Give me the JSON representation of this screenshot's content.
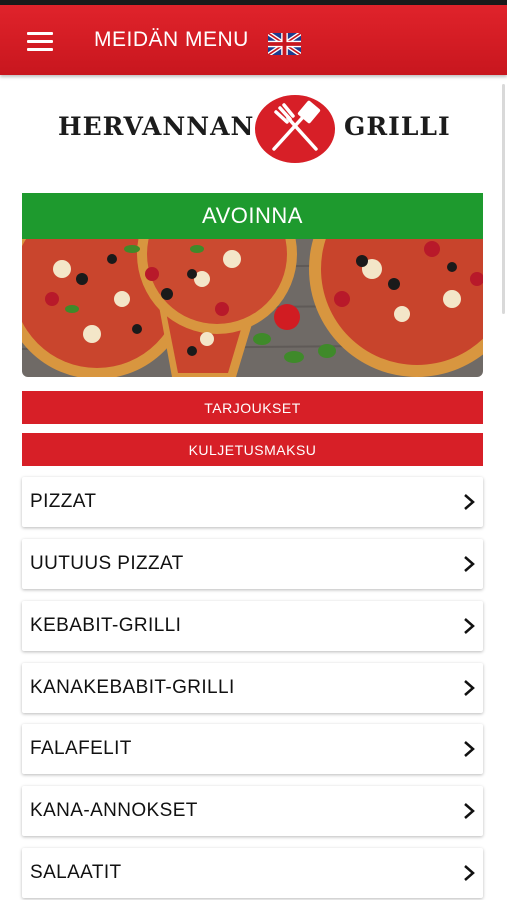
{
  "header": {
    "title": "MEIDÄN MENU",
    "menu_icon": "hamburger-icon",
    "language_icon": "uk-flag-icon"
  },
  "logo": {
    "left_text": "HERVANNAN",
    "right_text": "GRILLI",
    "emblem_icon": "fork-spatula-icon"
  },
  "status": {
    "label": "AVOINNA"
  },
  "hero": {
    "image": "pizza-photo"
  },
  "buttons": {
    "offers": "TARJOUKSET",
    "delivery": "KULJETUSMAKSU"
  },
  "categories": [
    {
      "label": "PIZZAT"
    },
    {
      "label": "UUTUUS PIZZAT"
    },
    {
      "label": "KEBABIT-GRILLI"
    },
    {
      "label": "KANAKEBABIT-GRILLI"
    },
    {
      "label": "FALAFELIT"
    },
    {
      "label": "KANA-ANNOKSET"
    },
    {
      "label": "SALAATIT"
    }
  ],
  "colors": {
    "brand_red": "#d71f27",
    "open_green": "#1e9a2e"
  }
}
